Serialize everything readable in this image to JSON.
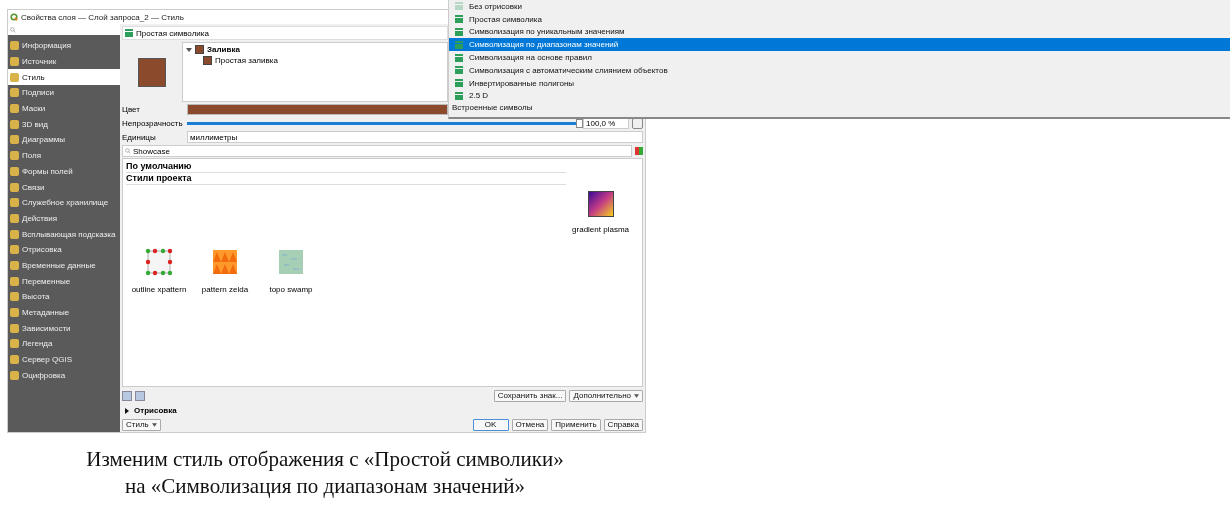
{
  "window": {
    "title": "Свойства слоя — Слой запроса_2 — Стиль"
  },
  "sidebar": {
    "items": [
      {
        "label": "Информация",
        "selected": false
      },
      {
        "label": "Источник",
        "selected": false
      },
      {
        "label": "Стиль",
        "selected": true
      },
      {
        "label": "Подписи",
        "selected": false
      },
      {
        "label": "Маски",
        "selected": false
      },
      {
        "label": "3D вид",
        "selected": false
      },
      {
        "label": "Диаграммы",
        "selected": false
      },
      {
        "label": "Поля",
        "selected": false
      },
      {
        "label": "Формы полей",
        "selected": false
      },
      {
        "label": "Связи",
        "selected": false
      },
      {
        "label": "Служебное хранилище",
        "selected": false
      },
      {
        "label": "Действия",
        "selected": false
      },
      {
        "label": "Всплывающая подсказка",
        "selected": false
      },
      {
        "label": "Отрисовка",
        "selected": false
      },
      {
        "label": "Временные данные",
        "selected": false
      },
      {
        "label": "Переменные",
        "selected": false
      },
      {
        "label": "Высота",
        "selected": false
      },
      {
        "label": "Метаданные",
        "selected": false
      },
      {
        "label": "Зависимости",
        "selected": false
      },
      {
        "label": "Легенда",
        "selected": false
      },
      {
        "label": "Сервер QGIS",
        "selected": false
      },
      {
        "label": "Оцифровка",
        "selected": false
      }
    ]
  },
  "renderer": {
    "value": "Простая символика"
  },
  "symbol_tree": {
    "label": "Заливка",
    "expanded": true,
    "children": [
      {
        "label": "Простая заливка"
      }
    ]
  },
  "color": {
    "label": "Цвет"
  },
  "opacity": {
    "label": "Непрозрачность",
    "level": 1.0,
    "value": "100,0 %"
  },
  "units": {
    "label": "Единицы",
    "value": "миллиметры"
  },
  "library_search": {
    "value": "Showcase"
  },
  "library": {
    "groups": [
      "По умолчанию",
      "Стили проекта"
    ],
    "symbols": [
      {
        "name": "gradient  plasma",
        "kind": "gradient"
      },
      {
        "name": "outline xpattern",
        "kind": "outline"
      },
      {
        "name": "pattern zelda",
        "kind": "pattern"
      },
      {
        "name": "topo swamp",
        "kind": "topo"
      }
    ]
  },
  "library_buttons": [
    "Сохранить знак...",
    "Дополнительно"
  ],
  "rendering_section": {
    "label": "Отрисовка",
    "expanded": false
  },
  "style_button": "Стиль",
  "buttons": [
    "OK",
    "Отмена",
    "Применить",
    "Справка"
  ],
  "renderer_menu": [
    {
      "label": "Без отрисовки",
      "kind": "option",
      "selected": false
    },
    {
      "label": "Простая символика",
      "kind": "option",
      "selected": false
    },
    {
      "label": "Символизация по уникальным значениям",
      "kind": "option",
      "selected": false
    },
    {
      "label": "Символизация по диапазонам значений",
      "kind": "option",
      "selected": true
    },
    {
      "label": "Символизация на основе правил",
      "kind": "option",
      "selected": false
    },
    {
      "label": "Символизация с автоматическим слиянием объектов",
      "kind": "option",
      "selected": false
    },
    {
      "label": "Инвертированные полигоны",
      "kind": "option",
      "selected": false
    },
    {
      "label": "2.5 D",
      "kind": "option",
      "selected": false
    },
    {
      "label": "Встроенные символы",
      "kind": "header",
      "selected": false
    }
  ],
  "caption": [
    "Изменим стиль отображения с «Простой символики»",
    "на «Символизация по диапазонам значений»"
  ]
}
